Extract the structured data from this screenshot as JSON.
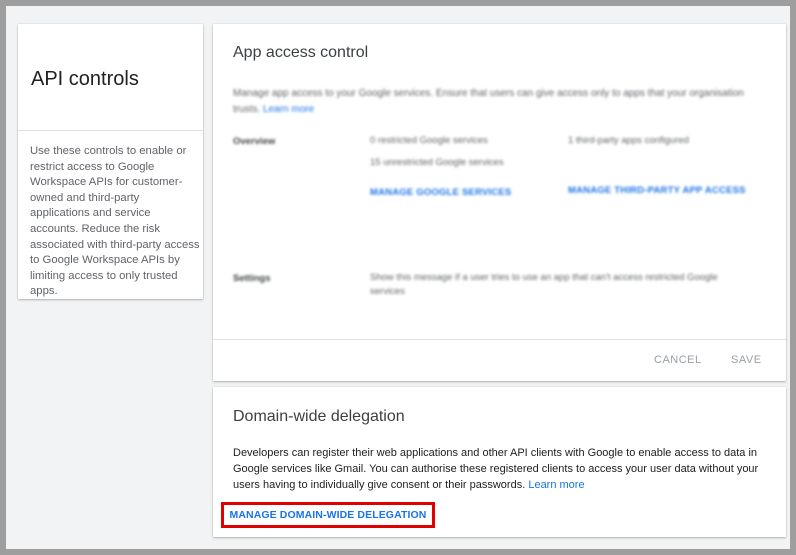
{
  "left_panel": {
    "title": "API controls",
    "description": "Use these controls to enable or restrict access to Google Workspace APIs for customer-owned and third-party applications and service accounts. Reduce the risk associated with third-party access to Google Workspace APIs by limiting access to only trusted apps."
  },
  "app_access": {
    "title": "App access control",
    "description": "Manage app access to your Google services. Ensure that users can give access only to apps that your organisation trusts.",
    "learn_more": "Learn more",
    "overview_label": "Overview",
    "restricted": "0 restricted Google services",
    "unrestricted": "15 unrestricted Google services",
    "third_party": "1 third-party apps configured",
    "manage_google_services": "MANAGE GOOGLE SERVICES",
    "manage_third_party": "MANAGE THIRD-PARTY APP ACCESS",
    "settings_label": "Settings",
    "settings_text": "Show this message if a user tries to use an app that can't access restricted Google services",
    "cancel": "CANCEL",
    "save": "SAVE"
  },
  "delegation": {
    "title": "Domain-wide delegation",
    "description": "Developers can register their web applications and other API clients with Google to enable access to data in Google services like Gmail. You can authorise these registered clients to access your user data without your users having to individually give consent or their passwords.",
    "learn_more": "Learn more",
    "manage_button": "MANAGE DOMAIN-WIDE DELEGATION"
  },
  "colors": {
    "accent": "#1a73e8",
    "highlight_border": "#e00000"
  }
}
